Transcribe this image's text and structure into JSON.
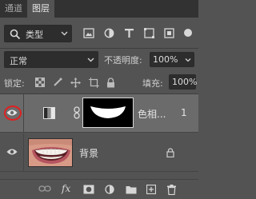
{
  "tabs": [
    {
      "label": "通道",
      "active": false
    },
    {
      "label": "图层",
      "active": true
    }
  ],
  "filter": {
    "kind_label": "类型",
    "icons": [
      "image-filter-icon",
      "adjustment-filter-icon",
      "text-filter-icon",
      "shape-filter-icon",
      "smart-object-filter-icon",
      "filter-toggle-icon"
    ]
  },
  "blend": {
    "mode": "正常",
    "opacity_label": "不透明度:",
    "opacity_value": "100%"
  },
  "lock": {
    "label": "锁定:",
    "icons": [
      "lock-transparent-pixels-icon",
      "lock-image-pixels-icon",
      "lock-position-icon",
      "lock-artboard-icon",
      "lock-all-icon"
    ],
    "fill_label": "填充:",
    "fill_value": "100%"
  },
  "layers": [
    {
      "name": "色相...",
      "extra": "1",
      "type": "adjustment",
      "visible": true,
      "selected": true
    },
    {
      "name": "背景",
      "type": "background",
      "visible": true,
      "selected": false,
      "locked": true
    }
  ],
  "bottom_icons": [
    "link-layers-icon",
    "fx-icon",
    "add-mask-icon",
    "adjustment-layer-icon",
    "group-icon",
    "new-layer-icon",
    "trash-icon"
  ],
  "bottom_fx_label": "fx",
  "colors": {
    "panel": "#535353",
    "tab_bar": "#323232",
    "field": "#2d2d2d",
    "selected_row": "#6b6b6b",
    "highlight_ring": "#e02020"
  }
}
